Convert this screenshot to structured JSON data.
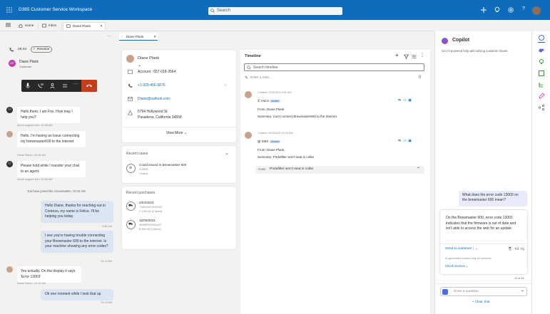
{
  "app": {
    "title": "D365 Customer Service Workspace",
    "search_placeholder": "Search"
  },
  "tabs": [
    {
      "label": "Home"
    },
    {
      "label": "Inbox"
    },
    {
      "label": "Diane Plank"
    }
  ],
  "session_tab": {
    "label": "Diane Plank"
  },
  "conversation": {
    "duration": "05:44",
    "status": "Resolve",
    "customer_name": "Diane Plank",
    "customer_role": "Customer",
    "messages": [
      {
        "from": "bot",
        "text": "Hello there, I am Fox. How may I help you?",
        "meta": "Azure support bot • 10:08 AM"
      },
      {
        "from": "customer",
        "text": "Hello, I'm having an issue connecting my brewmaster600 to the internet",
        "meta": "Diane Plank • 10:09 AM"
      },
      {
        "from": "bot",
        "text": "Please hold while I transfer your chat to an agent.",
        "meta": "Azure support bot • 10:09 AM"
      }
    ],
    "joined": "You have joined the conversation. 10:10 AM",
    "agent_msgs": [
      {
        "text": "Hello Diane, thanks for reaching out to Contoso, my name is Felice. I'll be helping you today.",
        "time": "9:46 AM"
      },
      {
        "text": "I see you're having trouble connecting your Brewmaster 600 to the internet. Is your machine showing any error codes?",
        "time": "10:11 AM"
      }
    ],
    "customer_reply": {
      "text": "Yes actually. On the display it says 'Error 13003'",
      "meta": "Diane Plank • 10:12 AM"
    },
    "agent_last": {
      "text": "Ok one moment while I look that up",
      "time": "10:13 AM"
    }
  },
  "customer": {
    "name": "Diane Plank",
    "account": "Account : 657-018-3564",
    "phone": "+1-929-456-9876",
    "email": "Diane@outlook.com",
    "address_line1": "5794 Hollywood St",
    "address_line2": "Pasadena, California 34558",
    "view_more": "View More",
    "recent_cases_title": "Recent cases",
    "case_title": "Could issued in Brewmaster 600",
    "case_id": "470532",
    "case_status": "Closed",
    "recent_purchases_title": "Recent purchases",
    "purchases": [
      {
        "date": "2/04/2023",
        "id": "7180LMFXG9OGS",
        "detail": "2 1100.00 (2 items)"
      },
      {
        "date": "12/05/2021",
        "id": "4RN8P9G0WQ4O",
        "detail": "$ 280.06 (1 items)"
      }
    ]
  },
  "timeline": {
    "title": "Timeline",
    "search_placeholder": "Search timeline",
    "note_placeholder": "Enter a note...",
    "items": [
      {
        "created": "Created: 2/15/2023 9:52 AM",
        "type": "Voice",
        "badge": "Active",
        "from": "From: Diane Plank",
        "summary": "Summary: Can't connect Brewmaster600 to the Internet"
      },
      {
        "created": "Created: 8/15/2023 10:10 AM",
        "type": "SMS",
        "badge": "Closed",
        "from": "From: Diane Plank",
        "summary": "Summary: Portafilter won't seat in collar"
      }
    ],
    "case_row": {
      "label": "Case",
      "value": "Portafilter won't seat in collar"
    }
  },
  "copilot": {
    "title": "Copilot",
    "subtitle": "Get AI-powered help with solving customer issues.",
    "user_question": "What does the error code 13003 on the brewmaster 600 mean?",
    "answer": "On the Brewmaster 600, error code 13003 indicates that the firmware is out of date and isn't able to access the web for an update.",
    "send_label": "Send to customer",
    "disclaimer": "AI-generated content may be incorrect",
    "check_sources": "Check sources",
    "count": "41 of 1k",
    "input_placeholder": "Enter a question",
    "clear_chat": "Clear chat"
  },
  "colors": {
    "brand": "#0f6cbd",
    "end_call": "#c43e1c",
    "active_badge": "#c7e0f4"
  },
  "icons": [
    "waffle-icon",
    "search-icon",
    "plus-icon",
    "lightbulb-icon",
    "gear-icon",
    "help-icon",
    "phone-icon",
    "mic-icon",
    "copilot-icon"
  ]
}
